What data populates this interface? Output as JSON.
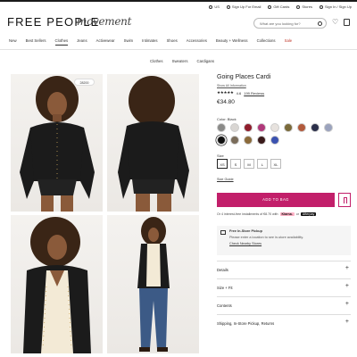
{
  "utility": {
    "region": "US",
    "signup_email": "Sign Up For Email",
    "gift_cards": "Gift Cards",
    "stores": "Stores",
    "signin": "Sign In / Sign Up"
  },
  "header": {
    "logo": "FREE PEOPLE",
    "logo2": "movement",
    "search_placeholder": "What are you looking for?"
  },
  "nav": [
    "New",
    "Best Sellers",
    "Clothes",
    "Jeans",
    "Activewear",
    "Swim",
    "Intimates",
    "Shoes",
    "Accessories",
    "Beauty + Wellness",
    "Collections",
    "Sale"
  ],
  "subnav": [
    "Clothes",
    "Sweaters",
    "Cardigans"
  ],
  "photo_badge": "28200",
  "product": {
    "title": "Going Places Cardi",
    "show_all": "Show All Information",
    "stars": "★★★★★",
    "rating": "4.6",
    "reviews": "199 Reviews",
    "price": "€34.80",
    "color_label": "Color: Black",
    "swatch_colors": [
      "#8a8a88",
      "#d9d6d3",
      "#8f1d2c",
      "#b0387a",
      "#e7e2de",
      "#7a6a3a",
      "#b25a3c",
      "#2b2f4a",
      "#9ba3bd",
      "#111111",
      "#7a6c5a",
      "#8b6a3a",
      "#3a1a1a",
      "#3b52b0"
    ],
    "selected_color_index": 9,
    "size_label": "Size",
    "sizes": [
      "XS",
      "S",
      "M",
      "L",
      "XL"
    ],
    "selected_size_index": 0,
    "size_guide": "Size Guide",
    "add_to_bag": "ADD TO BAG",
    "klarna_text": "Or 4 interest-free installments of €8.70 with",
    "klarna": "Klarna.",
    "or": "or",
    "afterpay": "Afterpay"
  },
  "pickup": {
    "title": "Free In-Store Pickup",
    "desc": "Please enter a location to see in-store availability.",
    "link": "Check Nearby Stores"
  },
  "accordions": [
    "Details",
    "Size + Fit",
    "Contents",
    "Shipping, In-Store Pickup, Returns"
  ]
}
